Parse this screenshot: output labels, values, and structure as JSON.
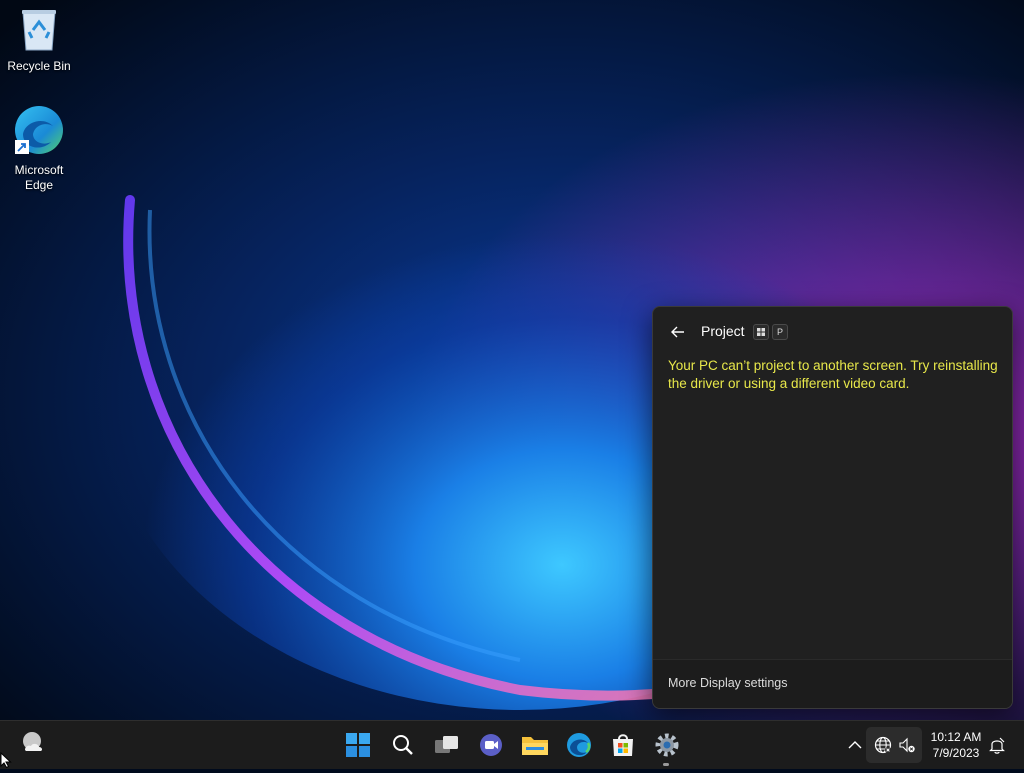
{
  "desktop": {
    "icons": [
      {
        "label": "Recycle Bin",
        "icon": "recycle-bin-icon"
      },
      {
        "label": "Microsoft Edge",
        "icon": "edge-icon"
      }
    ]
  },
  "flyout": {
    "title": "Project",
    "shortcut_keys": [
      "P"
    ],
    "message": "Your PC can’t project to another screen. Try reinstalling the driver or using a different video card.",
    "footer_link": "More Display settings",
    "message_color": "#e8e84a"
  },
  "taskbar": {
    "pinned": [
      "start-icon",
      "search-icon",
      "task-view-icon",
      "teams-chat-icon",
      "file-explorer-icon",
      "edge-icon",
      "store-icon",
      "settings-icon"
    ],
    "clock": {
      "time": "10:12 AM",
      "date": "7/9/2023"
    }
  }
}
